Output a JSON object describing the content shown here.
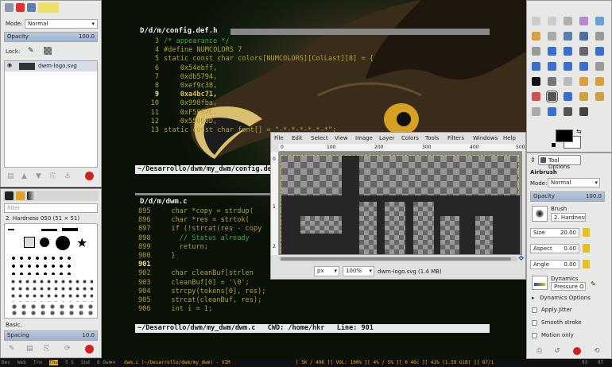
{
  "colors": {
    "accent": "#e0b020",
    "selection": "#9db2cf",
    "terminal_text": "#b4a030",
    "comment": "#3aa83a"
  },
  "layers_panel": {
    "mode_label": "Mode:",
    "mode_value": "Normal",
    "opacity_label": "Opacity",
    "opacity_value": "100.0",
    "lock_label": "Lock:",
    "layer_name": "dwm-logo.svg"
  },
  "brushes_panel": {
    "filter_placeholder": "filter",
    "brush_name": "2. Hardness 050 (51 × 51)",
    "preset_label": "Basic.",
    "spacing_label": "Spacing",
    "spacing_value": "10.0"
  },
  "terminal_top": {
    "title": "D/d/m/config.def.h",
    "line_numbers": [
      "3",
      "4",
      "5",
      "6",
      "7",
      "8",
      "9",
      "10",
      "11",
      "12",
      "13"
    ],
    "code": [
      "/* appearance */",
      "#define NUMCOLORS 7",
      "static const char colors[NUMCOLORS][ColLast][8] = {",
      "    0x54ebff,",
      "    0xdb5794,",
      "    0xef9c38,",
      "    0xa4bc71,",
      "    0x998fba,",
      "    0xF5F57C,",
      "    0x550D0D,",
      "static const char font[] = \"-*-*-*-*-*-*\";"
    ],
    "status": "~/Desarrollo/dwm/my_dwm/config.def.h"
  },
  "terminal_bottom": {
    "title": "D/d/m/dwm.c",
    "lines": [
      {
        "n": "895",
        "code": "    char *copy = strdup("
      },
      {
        "n": "896",
        "code": "    char *res = strtok("
      },
      {
        "n": "897",
        "code": "    if (!strcat(res - copy"
      },
      {
        "n": "898",
        "code": "      // Status already"
      },
      {
        "n": "899",
        "code": "      return;"
      },
      {
        "n": "900",
        "code": "    }"
      },
      {
        "n": "901",
        "code": ""
      },
      {
        "n": "902",
        "code": "    char cleanBuf[strlen"
      },
      {
        "n": "903",
        "code": "    cleanBuf[0] = '\\0';"
      },
      {
        "n": "904",
        "code": "    strcpy(tokens[0], res);"
      },
      {
        "n": "905",
        "code": "    strcat(cleanBuf, res);"
      },
      {
        "n": "906",
        "code": "    int i = 1;"
      }
    ],
    "status": "~/Desarrollo/dwm/my_dwm/dwm.c   CWD: /home/hkr   Line: 901"
  },
  "image_window": {
    "menu": [
      "File",
      "Edit",
      "Select",
      "View",
      "Image",
      "Layer",
      "Colors",
      "Tools",
      "Filters",
      "Windows",
      "Help"
    ],
    "ruler_h": [
      "0",
      "100",
      "200",
      "300",
      "400",
      "500"
    ],
    "ruler_v": [
      "0",
      "1",
      "2"
    ],
    "unit": "px",
    "zoom": "100%",
    "status": "dwm-logo.svg (1.4 MB)"
  },
  "tool_options": {
    "tab_label": "Tool Options",
    "tool_name": "Airbrush",
    "mode_label": "Mode:",
    "mode_value": "Normal",
    "opacity_label": "Opacity",
    "opacity_value": "100.0",
    "brush_label": "Brush",
    "brush_value": "2. Hardness",
    "size_label": "Size",
    "size_value": "20.00",
    "aspect_label": "Aspect",
    "aspect_value": "0.00",
    "angle_label": "Angle",
    "angle_value": "0.00",
    "dynamics_label": "Dynamics",
    "dynamics_value": "Pressure O",
    "dynamics_options": "Dynamics Options",
    "apply_jitter": "Apply Jitter",
    "smooth_stroke": "Smooth stroke",
    "motion_only": "Motion only"
  },
  "bottom_bar": {
    "tags": [
      "Dev",
      "Web",
      "Trm",
      "Thu",
      "5 S",
      "Snd",
      "8 Own"
    ],
    "layout": "><",
    "title": "dwm.c (~/Desarrollo/dwm/my_dwm) - VIM",
    "stats": "[ 5K / 49K ][ VOL: 100% ][ 4% / 5% ][ 0 46c ][ 41% (1.59 GiB) ][ 87/1",
    "trays": [
      "93",
      "87"
    ]
  }
}
